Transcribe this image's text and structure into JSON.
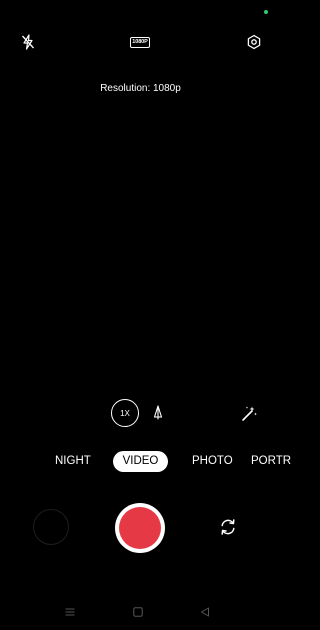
{
  "status": {
    "indicator_color": "#2ecc71",
    "indicator": "green-dot"
  },
  "top_bar": {
    "flash_icon": "flash-off-icon",
    "resolution_badge": "1080P",
    "settings_icon": "settings-hexagon-icon"
  },
  "resolution_text": "Resolution: 1080p",
  "controls": {
    "zoom_label": "1X",
    "tripod_icon": "tripod-icon",
    "beauty_icon": "magic-wand-icon"
  },
  "modes": {
    "night": "NIGHT",
    "video": "VIDEO",
    "photo": "PHOTO",
    "portrait": "PORTR",
    "selected": "VIDEO"
  },
  "capture": {
    "shutter_color": "#e63946",
    "gallery_icon": "gallery-thumbnail",
    "switch_icon": "camera-switch-icon"
  },
  "nav": {
    "menu_icon": "menu-icon",
    "home_icon": "home-square-icon",
    "back_icon": "back-triangle-icon"
  }
}
